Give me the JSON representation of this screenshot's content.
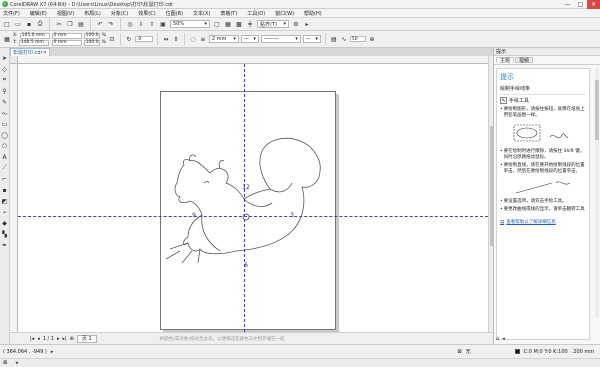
{
  "window": {
    "title": "CorelDRAW X7 (64-Bit) - D:\\Users\\Linux\\Desktop\\打印\\松鼠打印.cdr",
    "min": "—",
    "max": "□",
    "close": "✕"
  },
  "menu": [
    "文件(F)",
    "编辑(E)",
    "视图(V)",
    "布局(L)",
    "对象(C)",
    "效果(C)",
    "位图(B)",
    "文本(X)",
    "表格(T)",
    "工具(O)",
    "窗口(W)",
    "帮助(H)"
  ],
  "toolbar": {
    "zoom": "50%",
    "snap": "贴齐(T)"
  },
  "props": {
    "x": "105.0 mm",
    "y": "148.5 mm",
    "w": "0 mm",
    "h": "0 mm",
    "sx": "100.0",
    "sy": "100.0",
    "unit": "%",
    "angle": ".0",
    "outline": "2 mm",
    "smooth": "50"
  },
  "doc_tab": "松鼠打印.cdr",
  "canvas": {
    "label_top": "12",
    "label_left": "9",
    "label_right": "3",
    "label_bottom": "6"
  },
  "pagebar": {
    "page": "1 / 1",
    "tab": "页 1",
    "drag_hint": "将颜色(或对象)拖动至此处，以便将这些颜色与文档存储在一起"
  },
  "docker": {
    "header": "提示",
    "tabs": [
      "主题",
      "视频"
    ],
    "title": "提示",
    "subtitle": "绘制手绘线条",
    "tool": "手绘工具",
    "bullets": [
      "要绘制图形，请按住按钮，就像在纸张上用铅笔画图一样。",
      "要在绘制时进行擦除，请按住 Shift 键，同时沿原路拖动鼠标。",
      "要绘制直线，请在要开始绘制线段的位置单击，然后在要绘制线段的位置单击。",
      "要设置选项，请双击手绘工具。",
      "要更改曲线或线的显示，请单击翻转工具"
    ],
    "more": "查看帮助以了解详细信息"
  },
  "status": {
    "coords": "( 364.064 , -949 )",
    "none_label": "无",
    "color_info": "C:0 M:0 Y:0 K:100",
    "outline_w": ".200 mm"
  }
}
